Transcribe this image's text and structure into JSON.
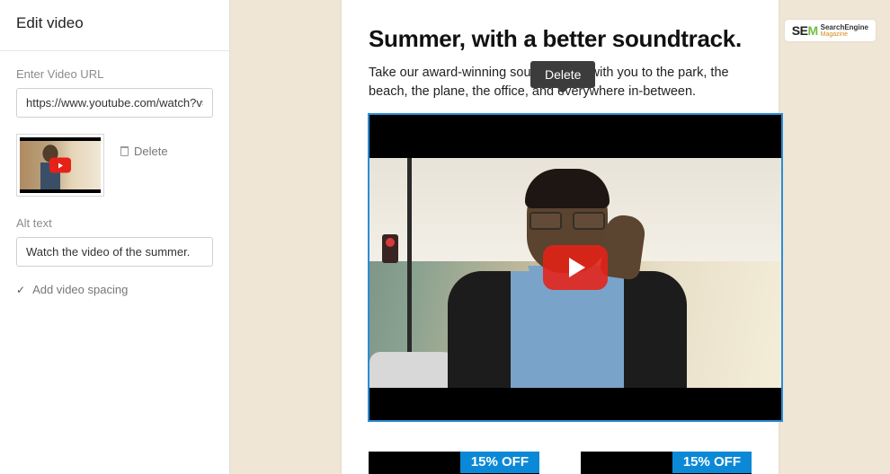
{
  "sidebar": {
    "title": "Edit video",
    "url_label": "Enter Video URL",
    "url_value": "https://www.youtube.com/watch?v=Fl",
    "delete_label": "Delete",
    "alt_label": "Alt text",
    "alt_value": "Watch the video of the summer.",
    "spacing_label": "Add video spacing"
  },
  "content": {
    "headline": "Summer, with a better soundtrack.",
    "body": "Take our award-winning sound quality with you to the park, the beach, the plane, the office, and everywhere in-between."
  },
  "tooltip": {
    "text": "Delete"
  },
  "promo": {
    "badge1": "15% OFF",
    "badge2": "15% OFF"
  },
  "watermark": {
    "prefix": "SE",
    "suffix": "M",
    "line1": "SearchEngine",
    "line2": "Magazine"
  }
}
